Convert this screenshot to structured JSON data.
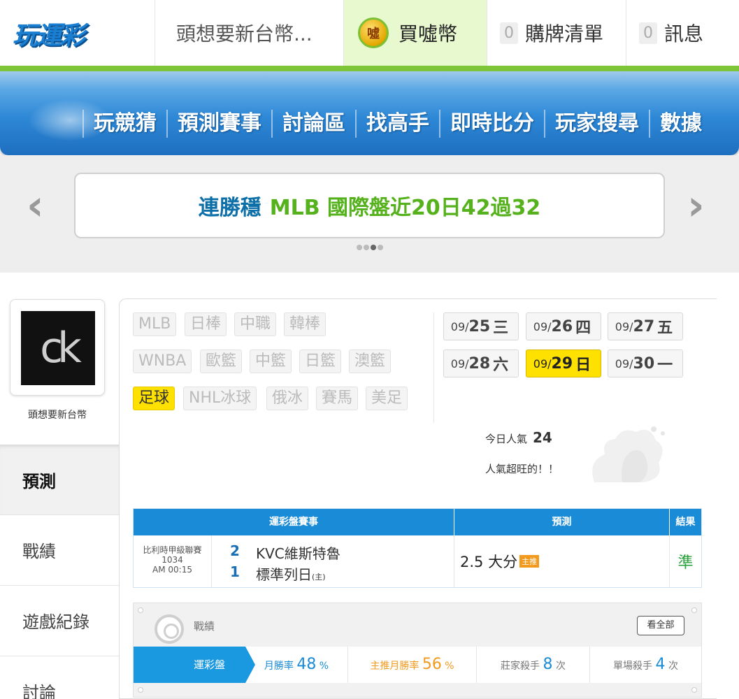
{
  "header": {
    "logo_text": "玩運彩",
    "user_label": "頭想要新台幣...",
    "buy_coin_icon_text": "噓",
    "buy_label": "買噓幣",
    "cart_count": "0",
    "cart_label": "購牌清單",
    "msg_count": "0",
    "msg_label": "訊息"
  },
  "nav": [
    "玩競猜",
    "預測賽事",
    "討論區",
    "找高手",
    "即時比分",
    "玩家搜尋",
    "數據"
  ],
  "banner": {
    "text_blue": "連勝穩",
    "text_green": "MLB 國際盤近20日42過32",
    "prev_arrow": "‹",
    "next_arrow": "›"
  },
  "profile": {
    "avatar_text": "ck",
    "name": "頭想要新台幣"
  },
  "side_tabs": [
    "預測",
    "戰績",
    "遊戲紀錄",
    "討論"
  ],
  "sports": [
    {
      "label": "MLB",
      "active": false
    },
    {
      "label": "日棒",
      "active": false
    },
    {
      "label": "中職",
      "active": false
    },
    {
      "label": "韓棒",
      "active": false
    },
    {
      "label": "WNBA",
      "active": false
    },
    {
      "label": "歐籃",
      "active": false
    },
    {
      "label": "中籃",
      "active": false
    },
    {
      "label": "日籃",
      "active": false
    },
    {
      "label": "澳籃",
      "active": false
    },
    {
      "label": "足球",
      "active": true
    },
    {
      "label": "NHL冰球",
      "active": false
    },
    {
      "label": "俄冰",
      "active": false
    },
    {
      "label": "賽馬",
      "active": false
    },
    {
      "label": "美足",
      "active": false
    }
  ],
  "dates": [
    {
      "month": "09/",
      "day": "25",
      "weekday": "三",
      "active": false
    },
    {
      "month": "09/",
      "day": "26",
      "weekday": "四",
      "active": false
    },
    {
      "month": "09/",
      "day": "27",
      "weekday": "五",
      "active": false
    },
    {
      "month": "09/",
      "day": "28",
      "weekday": "六",
      "active": false
    },
    {
      "month": "09/",
      "day": "29",
      "weekday": "日",
      "active": true
    },
    {
      "month": "09/",
      "day": "30",
      "weekday": "一",
      "active": false
    }
  ],
  "popularity": {
    "label": "今日人氣",
    "value": "24",
    "subtitle": "人氣超旺的！！"
  },
  "table": {
    "headers": [
      "運彩盤賽事",
      "預測",
      "結果"
    ],
    "row": {
      "league": "比利時甲級聯賽",
      "game_no": "1034",
      "time": "AM 00:15",
      "score1": "2",
      "team1": "KVC維斯特魯",
      "score2": "1",
      "team2": "標準列日",
      "home_mark": "(主)",
      "prediction": "2.5 大分",
      "pred_tag": "主推",
      "result": "準"
    }
  },
  "record": {
    "title": "戰績",
    "view_all": "看全部",
    "label": "運彩盤",
    "stats": [
      {
        "label": "月勝率",
        "value": "48",
        "unit": "%"
      },
      {
        "label": "主推月勝率",
        "value": "56",
        "unit": "%"
      },
      {
        "label": "莊家殺手",
        "value": "8",
        "unit": "次"
      },
      {
        "label": "單場殺手",
        "value": "4",
        "unit": "次"
      }
    ]
  },
  "colors": {
    "nav_blue": "#2e88d6",
    "accent_green": "#7ec638",
    "active_yellow": "#ffe100",
    "banner_green": "#55b11c",
    "banner_blue": "#0c6fa8"
  }
}
